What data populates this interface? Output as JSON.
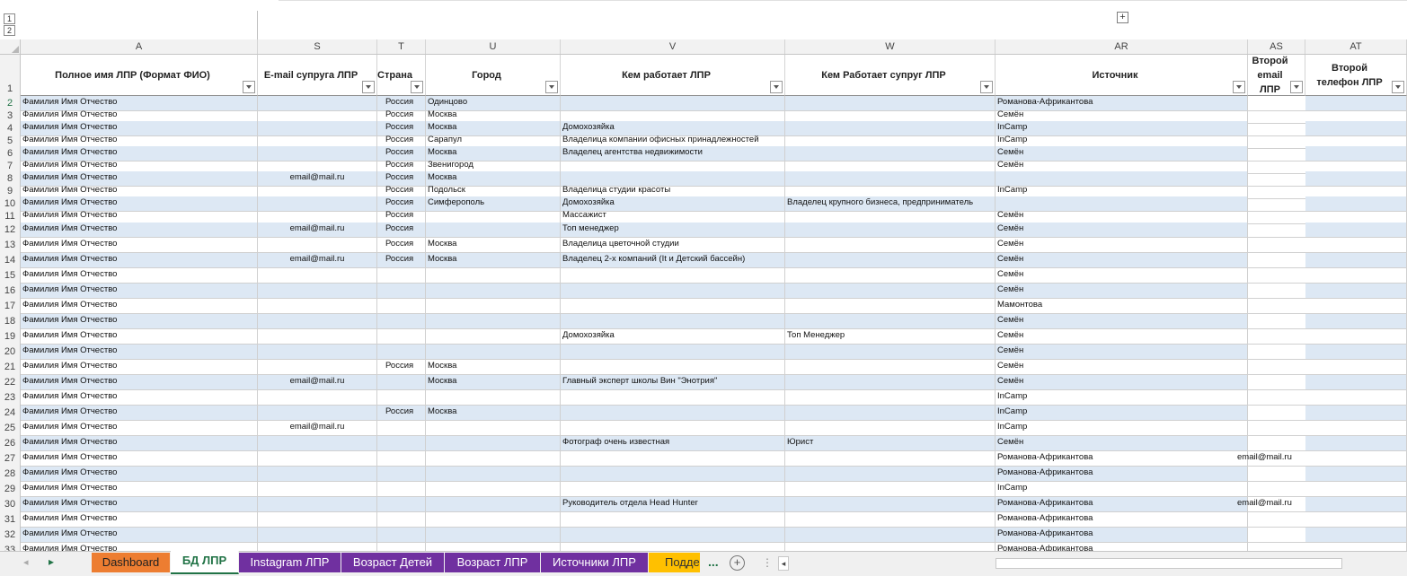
{
  "outline": {
    "level1": "1",
    "level2": "2",
    "expand": "+"
  },
  "columns": [
    {
      "letter": "A",
      "header": "Полное имя ЛПР (Формат ФИО)"
    },
    {
      "letter": "S",
      "header": "E-mail супруга ЛПР"
    },
    {
      "letter": "T",
      "header": "Страна"
    },
    {
      "letter": "U",
      "header": "Город"
    },
    {
      "letter": "V",
      "header": "Кем работает ЛПР"
    },
    {
      "letter": "W",
      "header": "Кем Работает супруг ЛПР"
    },
    {
      "letter": "AR",
      "header": "Источник"
    },
    {
      "letter": "AS",
      "header": "Второй email ЛПР"
    },
    {
      "letter": "AT",
      "header": "Второй телефон ЛПР"
    }
  ],
  "header_row_number": "1",
  "rows": [
    {
      "n": "2",
      "a": "Фамилия Имя Отчество",
      "s": "",
      "t": "Россия",
      "u": "Одинцово",
      "v": "",
      "w": "",
      "ar": "Романова-Африкантова",
      "as": ""
    },
    {
      "n": "3",
      "a": "Фамилия Имя Отчество",
      "s": "",
      "t": "Россия",
      "u": "Москва",
      "v": "",
      "w": "",
      "ar": "Семён",
      "as": ""
    },
    {
      "n": "4",
      "a": "Фамилия Имя Отчество",
      "s": "",
      "t": "Россия",
      "u": "Москва",
      "v": "Домохозяйка",
      "w": "",
      "ar": "InCamp",
      "as": ""
    },
    {
      "n": "5",
      "a": "Фамилия Имя Отчество",
      "s": "",
      "t": "Россия",
      "u": "Сарапул",
      "v": "Владелица компании офисных принадлежностей",
      "w": "",
      "ar": "InCamp",
      "as": ""
    },
    {
      "n": "6",
      "a": "Фамилия Имя Отчество",
      "s": "",
      "t": "Россия",
      "u": "Москва",
      "v": "Владелец агентства недвижимости",
      "w": "",
      "ar": "Семён",
      "as": ""
    },
    {
      "n": "7",
      "a": "Фамилия Имя Отчество",
      "s": "",
      "t": "Россия",
      "u": "Звенигород",
      "v": "",
      "w": "",
      "ar": "Семён",
      "as": ""
    },
    {
      "n": "8",
      "a": "Фамилия Имя Отчество",
      "s": "email@mail.ru",
      "t": "Россия",
      "u": "Москва",
      "v": "",
      "w": "",
      "ar": "",
      "as": ""
    },
    {
      "n": "9",
      "a": "Фамилия Имя Отчество",
      "s": "",
      "t": "Россия",
      "u": " Подольск",
      "v": "Владелица студии красоты",
      "w": "",
      "ar": "InCamp",
      "as": ""
    },
    {
      "n": "10",
      "a": "Фамилия Имя Отчество",
      "s": "",
      "t": "Россия",
      "u": "Симферополь",
      "v": "Домохозяйка",
      "w": "Владелец крупного бизнеса, предприниматель",
      "ar": "",
      "as": ""
    },
    {
      "n": "11",
      "a": "Фамилия Имя Отчество",
      "s": "",
      "t": "Россия",
      "u": "",
      "v": "Массажист",
      "w": "",
      "ar": "Семён",
      "as": ""
    },
    {
      "n": "12",
      "a": "Фамилия Имя Отчество",
      "s": "email@mail.ru",
      "t": "Россия",
      "u": "",
      "v": "Топ менеджер",
      "w": "",
      "ar": "Семён",
      "as": ""
    },
    {
      "n": "13",
      "a": "Фамилия Имя Отчество",
      "s": "",
      "t": "Россия",
      "u": "Москва",
      "v": "Владелица цветочной студии",
      "w": "",
      "ar": "Семён",
      "as": ""
    },
    {
      "n": "14",
      "a": "Фамилия Имя Отчество",
      "s": "email@mail.ru",
      "t": "Россия",
      "u": "Москва",
      "v": "Владелец 2-х компаний (It и Детский бассейн)",
      "w": "",
      "ar": "Семён",
      "as": ""
    },
    {
      "n": "15",
      "a": "Фамилия Имя Отчество",
      "s": "",
      "t": "",
      "u": "",
      "v": "",
      "w": "",
      "ar": "Семён",
      "as": ""
    },
    {
      "n": "16",
      "a": "Фамилия Имя Отчество",
      "s": "",
      "t": "",
      "u": "",
      "v": "",
      "w": "",
      "ar": "Семён",
      "as": ""
    },
    {
      "n": "17",
      "a": "Фамилия Имя Отчество",
      "s": "",
      "t": "",
      "u": "",
      "v": "",
      "w": "",
      "ar": "Мамонтова",
      "as": ""
    },
    {
      "n": "18",
      "a": "Фамилия Имя Отчество",
      "s": "",
      "t": "",
      "u": "",
      "v": "",
      "w": "",
      "ar": "Семён",
      "as": ""
    },
    {
      "n": "19",
      "a": "Фамилия Имя Отчество",
      "s": "",
      "t": "",
      "u": "",
      "v": "Домохозяйка",
      "w": "Топ Менеджер",
      "ar": "Семён",
      "as": ""
    },
    {
      "n": "20",
      "a": "Фамилия Имя Отчество",
      "s": "",
      "t": "",
      "u": "",
      "v": "",
      "w": "",
      "ar": "Семён",
      "as": ""
    },
    {
      "n": "21",
      "a": "Фамилия Имя Отчество",
      "s": "",
      "t": "Россия",
      "u": "Москва",
      "v": "",
      "w": "",
      "ar": "Семён",
      "as": ""
    },
    {
      "n": "22",
      "a": "Фамилия Имя Отчество",
      "s": "email@mail.ru",
      "t": "",
      "u": "Москва",
      "v": "Главный эксперт школы Вин \"Энотрия\"",
      "w": "",
      "ar": "Семён",
      "as": ""
    },
    {
      "n": "23",
      "a": "Фамилия Имя Отчество",
      "s": "",
      "t": "",
      "u": "",
      "v": "",
      "w": "",
      "ar": "InCamp",
      "as": ""
    },
    {
      "n": "24",
      "a": "Фамилия Имя Отчество",
      "s": "",
      "t": "Россия",
      "u": "Москва",
      "v": "",
      "w": "",
      "ar": "InCamp",
      "as": ""
    },
    {
      "n": "25",
      "a": "Фамилия Имя Отчество",
      "s": "email@mail.ru",
      "t": "",
      "u": "",
      "v": "",
      "w": "",
      "ar": "InCamp",
      "as": ""
    },
    {
      "n": "26",
      "a": "Фамилия Имя Отчество",
      "s": "",
      "t": "",
      "u": "",
      "v": "Фотограф очень известная",
      "w": "Юрист",
      "ar": "Семён",
      "as": ""
    },
    {
      "n": "27",
      "a": "Фамилия Имя Отчество",
      "s": "",
      "t": "",
      "u": "",
      "v": "",
      "w": "",
      "ar": "Романова-Африкантова",
      "as": "email@mail.ru"
    },
    {
      "n": "28",
      "a": "Фамилия Имя Отчество",
      "s": "",
      "t": "",
      "u": "",
      "v": "",
      "w": "",
      "ar": "Романова-Африкантова",
      "as": ""
    },
    {
      "n": "29",
      "a": "Фамилия Имя Отчество",
      "s": "",
      "t": "",
      "u": "",
      "v": "",
      "w": "",
      "ar": "InCamp",
      "as": ""
    },
    {
      "n": "30",
      "a": "Фамилия Имя Отчество",
      "s": "",
      "t": "",
      "u": "",
      "v": "Руководитель отдела Head Hunter",
      "w": "",
      "ar": "Романова-Африкантова",
      "as": "email@mail.ru"
    },
    {
      "n": "31",
      "a": "Фамилия Имя Отчество",
      "s": "",
      "t": "",
      "u": "",
      "v": "",
      "w": "",
      "ar": "Романова-Африкантова",
      "as": ""
    },
    {
      "n": "32",
      "a": "Фамилия Имя Отчество",
      "s": "",
      "t": "",
      "u": "",
      "v": "",
      "w": "",
      "ar": "Романова-Африкантова",
      "as": ""
    },
    {
      "n": "33",
      "a": "Фамилия Имя Отчество",
      "s": "",
      "t": "",
      "u": "",
      "v": "",
      "w": "",
      "ar": "Романова-Африкантова",
      "as": ""
    }
  ],
  "tabs": [
    {
      "label": "Dashboard",
      "color": "#ed7d31",
      "active": false
    },
    {
      "label": "БД ЛПР",
      "color": "#ffffff",
      "active": true
    },
    {
      "label": "Instagram ЛПР",
      "color": "#7030a0",
      "active": false
    },
    {
      "label": "Возраст Детей",
      "color": "#7030a0",
      "active": false
    },
    {
      "label": "Возраст ЛПР",
      "color": "#7030a0",
      "active": false
    },
    {
      "label": "Источники ЛПР",
      "color": "#7030a0",
      "active": false
    },
    {
      "label": "Подде",
      "color": "#ffc000",
      "active": false
    }
  ],
  "tab_nav": {
    "next": "▸",
    "more": "...",
    "add": "+",
    "scroll_left": "◂"
  },
  "colors": {
    "band": "#dde8f4",
    "header_bg": "#f2f2f2",
    "active_tab_text": "#217346"
  }
}
